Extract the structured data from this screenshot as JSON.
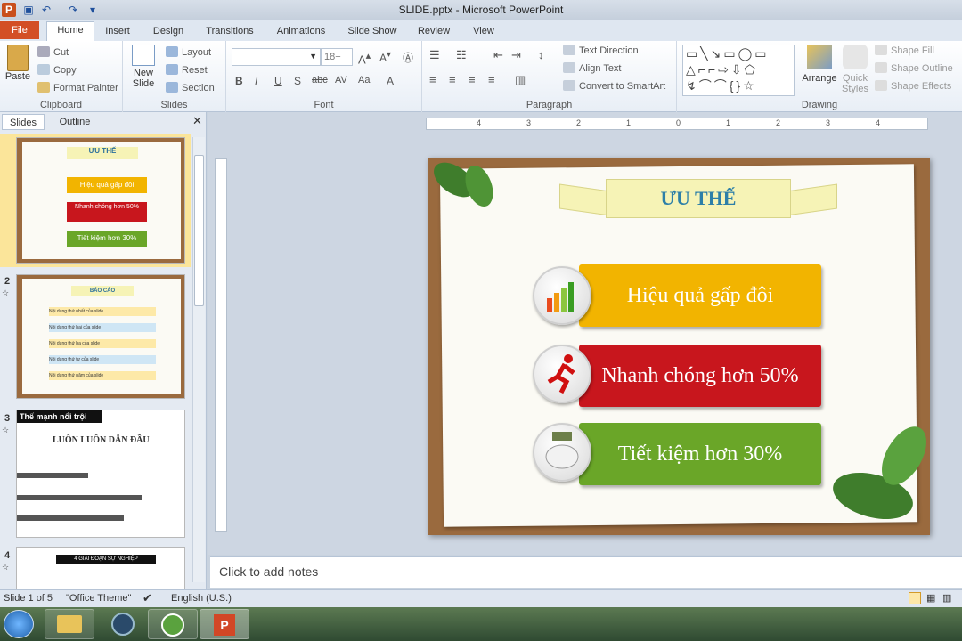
{
  "title": "SLIDE.pptx  -  Microsoft PowerPoint",
  "tabs": [
    "File",
    "Home",
    "Insert",
    "Design",
    "Transitions",
    "Animations",
    "Slide Show",
    "Review",
    "View"
  ],
  "ribbon": {
    "clipboard": {
      "paste": "Paste",
      "cut": "Cut",
      "copy": "Copy",
      "format_painter": "Format Painter",
      "label": "Clipboard"
    },
    "slides": {
      "new_slide_1": "New",
      "new_slide_2": "Slide",
      "layout": "Layout",
      "reset": "Reset",
      "section": "Section",
      "label": "Slides"
    },
    "font": {
      "size": "18+",
      "label": "Font"
    },
    "paragraph": {
      "text_direction": "Text Direction",
      "align_text": "Align Text",
      "convert_smartart": "Convert to SmartArt",
      "label": "Paragraph"
    },
    "drawing": {
      "arrange": "Arrange",
      "quick_styles_1": "Quick",
      "quick_styles_2": "Styles",
      "shape_fill": "Shape Fill",
      "shape_outline": "Shape Outline",
      "shape_effects": "Shape Effects",
      "label": "Drawing"
    }
  },
  "pane_tabs": {
    "slides": "Slides",
    "outline": "Outline"
  },
  "thumbnails": [
    {
      "num": "1",
      "title": "ƯU THẾ",
      "items": [
        "Hiệu quả gấp đôi",
        "Nhanh chóng hơn 50%",
        "Tiết kiệm hơn 30%"
      ]
    },
    {
      "num": "2",
      "title": "BÁO CÁO",
      "items": [
        "Nội dung thứ nhất của slide",
        "Nội dung thứ hai của slide",
        "Nội dung thứ ba của slide",
        "Nội dung thứ tư của slide",
        "Nội dung thứ năm của slide"
      ]
    },
    {
      "num": "3",
      "title": "Thế mạnh nổi trội",
      "subtitle": "LUÔN LUÔN DẪN ĐẦU"
    },
    {
      "num": "4",
      "title": "4 GIAI ĐOẠN SỰ NGHIỆP"
    }
  ],
  "ruler_h": [
    "4",
    "3",
    "2",
    "1",
    "0",
    "1",
    "2",
    "3",
    "4"
  ],
  "slide": {
    "title": "ƯU THẾ",
    "items": [
      {
        "text": "Hiệu quả gấp đôi",
        "color": "#f2b400"
      },
      {
        "text": "Nhanh chóng hơn 50%",
        "color": "#c8161d"
      },
      {
        "text": "Tiết kiệm hơn 30%",
        "color": "#6aa628"
      }
    ]
  },
  "notes_placeholder": "Click to add notes",
  "status": {
    "slide": "Slide 1 of 5",
    "theme": "\"Office Theme\"",
    "language": "English (U.S.)"
  }
}
